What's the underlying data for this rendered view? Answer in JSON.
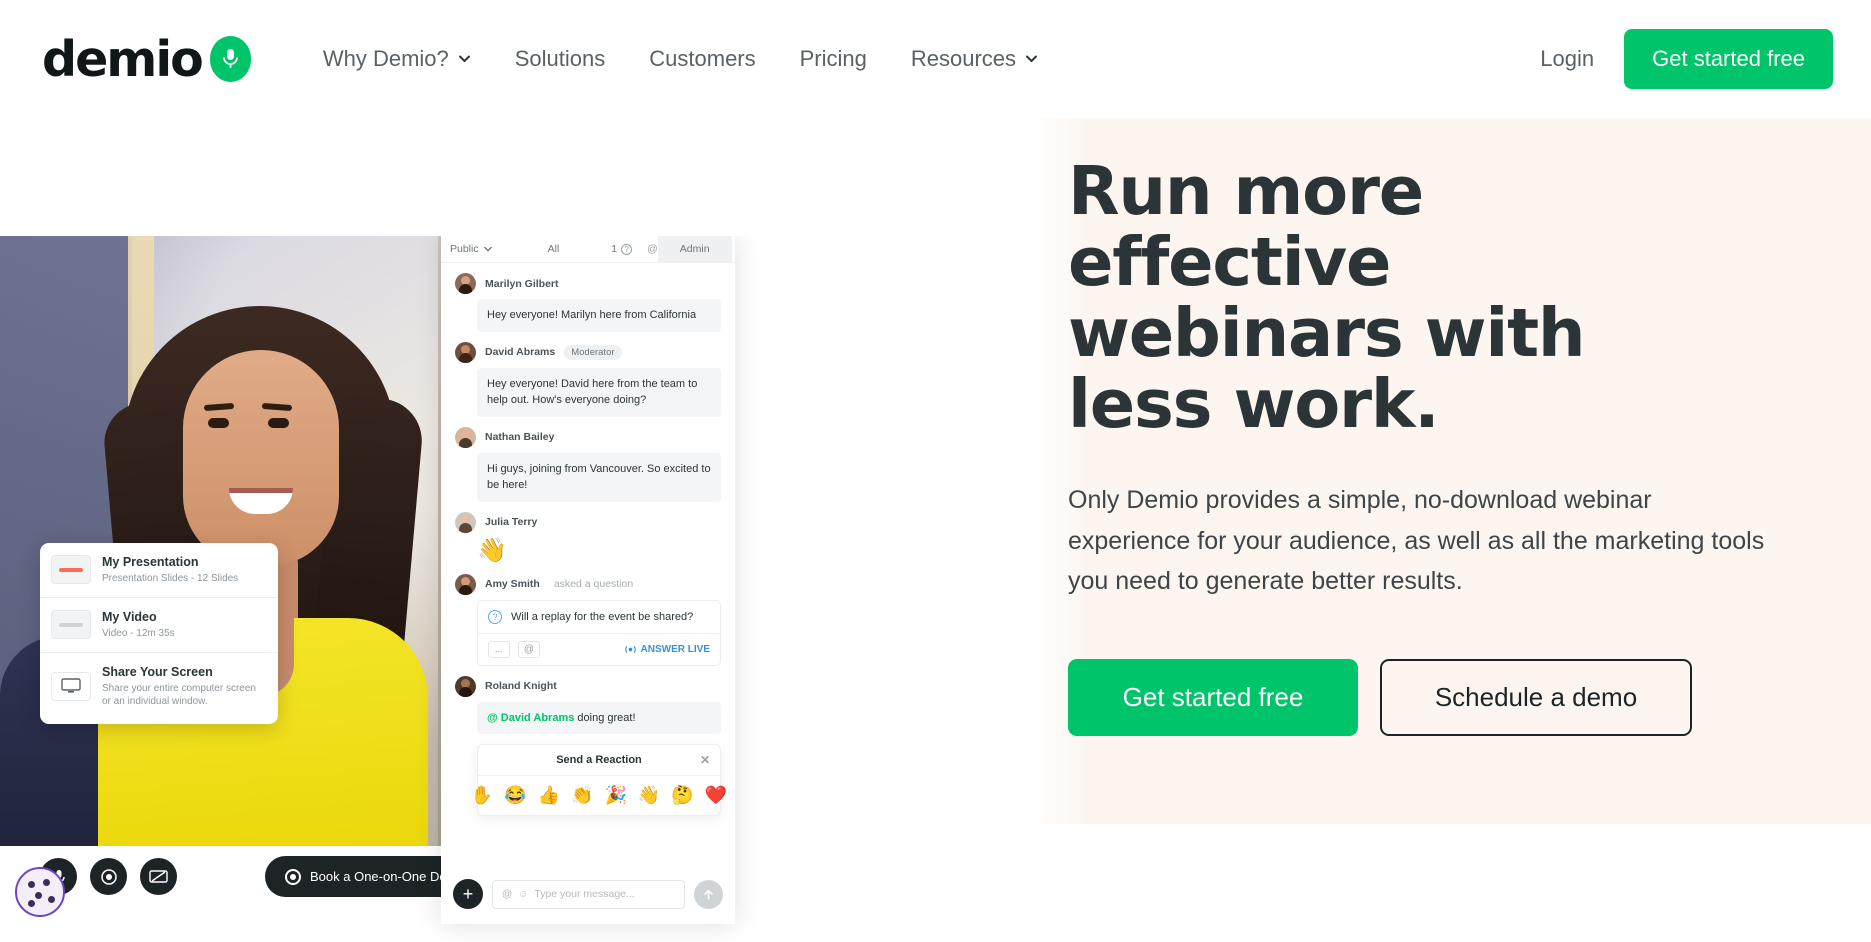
{
  "nav": {
    "logo_text": "demio",
    "logo_icon": "demio-mark-icon",
    "links": [
      {
        "label": "Why Demio?",
        "has_caret": true
      },
      {
        "label": "Solutions",
        "has_caret": false
      },
      {
        "label": "Customers",
        "has_caret": false
      },
      {
        "label": "Pricing",
        "has_caret": false
      },
      {
        "label": "Resources",
        "has_caret": true
      }
    ],
    "login_label": "Login",
    "cta_label": "Get started free"
  },
  "hero": {
    "title": "Run more effective webinars with less work.",
    "subtitle": "Only Demio provides a simple, no-download webinar experience for your audience, as well as all the marketing tools you need to generate better results.",
    "primary_cta": "Get started free",
    "secondary_cta": "Schedule a demo",
    "bg_color": "#fdf6f0",
    "accent_color": "#00c46a",
    "text_color": "#2b3538"
  },
  "product": {
    "media_card": {
      "items": [
        {
          "title": "My Presentation",
          "subtitle": "Presentation Slides - 12 Slides",
          "icon": "slides-thumb-icon"
        },
        {
          "title": "My Video",
          "subtitle": "Video - 12m 35s",
          "icon": "video-thumb-icon"
        },
        {
          "title": "Share Your Screen",
          "subtitle": "Share your entire computer screen or an individual window.",
          "icon": "monitor-icon"
        }
      ]
    },
    "controls": [
      {
        "name": "microphone-icon"
      },
      {
        "name": "camera-icon"
      },
      {
        "name": "share-screen-icon"
      }
    ],
    "demo_pill": "Book a One-on-One Demo"
  },
  "chat": {
    "header": {
      "scope": "Public",
      "filter": "All",
      "question_count": "1",
      "mention_icon": "@",
      "admin_tab": "Admin"
    },
    "messages": [
      {
        "name": "Marilyn Gilbert",
        "badge": "",
        "meta": "",
        "text": "Hey everyone! Marilyn here from California",
        "type": "text"
      },
      {
        "name": "David Abrams",
        "badge": "Moderator",
        "meta": "",
        "text": "Hey everyone! David here from the team to help out. How's everyone doing?",
        "type": "text"
      },
      {
        "name": "Nathan Bailey",
        "badge": "",
        "meta": "",
        "text": "Hi guys, joining from Vancouver. So excited to be here!",
        "type": "text"
      },
      {
        "name": "Julia Terry",
        "badge": "",
        "meta": "",
        "text": "👋",
        "type": "emoji"
      }
    ],
    "question": {
      "name": "Amy Smith",
      "meta": "asked a question",
      "text": "Will a replay for the event be shared?",
      "more_button": "...",
      "mention_button": "@",
      "answer_live_label": "ANSWER LIVE"
    },
    "reply": {
      "name": "Roland Knight",
      "mention": "@ David Abrams",
      "text": " doing great!"
    },
    "reaction_panel": {
      "title": "Send a Reaction",
      "close": "✕",
      "emojis": [
        "✋",
        "😂",
        "👍",
        "👏",
        "🎉",
        "👋",
        "🤔",
        "❤️"
      ]
    },
    "composer": {
      "placeholder": "Type your message...",
      "plus_label": "+",
      "send_icon": "send-arrow-icon"
    }
  },
  "cookie_widget": {
    "name": "cookie-consent-icon"
  }
}
